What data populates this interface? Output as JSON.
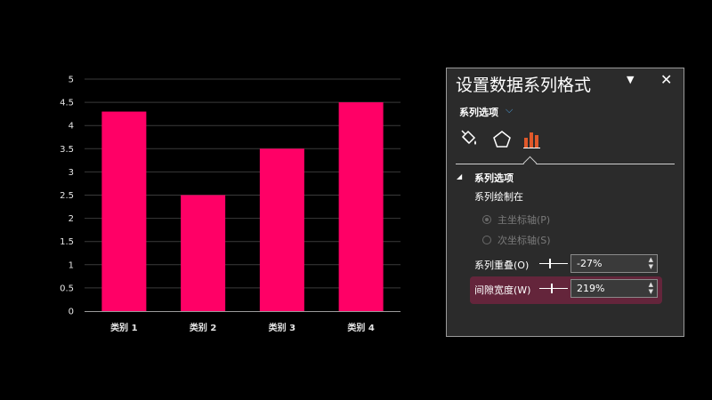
{
  "chart_data": {
    "type": "bar",
    "categories": [
      "类别 1",
      "类别 2",
      "类别 3",
      "类别 4"
    ],
    "values": [
      4.3,
      2.5,
      3.5,
      4.5
    ],
    "yticks": [
      "0",
      "0.5",
      "1",
      "1.5",
      "2",
      "2.5",
      "3",
      "3.5",
      "4",
      "4.5",
      "5"
    ],
    "ylim": [
      0,
      5
    ],
    "bar_color": "#FF0066",
    "grid": true
  },
  "pane": {
    "title": "设置数据系列格式",
    "dropdown_icon": "caret-down-icon",
    "close_label": "✕",
    "subtitle": "系列选项",
    "subtitle_chevron": "⌵",
    "tabs": [
      "fill-line-icon",
      "effects-pentagon-icon",
      "series-options-bars-icon"
    ],
    "active_tab": "series-options-bars-icon",
    "accent_color": "#E0592B",
    "section_title": "系列选项",
    "plot_on_label": "系列绘制在",
    "radios": [
      {
        "label": "主坐标轴(P)",
        "checked": true
      },
      {
        "label": "次坐标轴(S)",
        "checked": false
      }
    ],
    "overlap_label": "系列重叠(O)",
    "overlap_value": "-27%",
    "overlap_fraction": 0.365,
    "gap_label": "间隙宽度(W)",
    "gap_value": "219%",
    "gap_fraction": 0.44,
    "highlight_color": "#AA1E50"
  }
}
